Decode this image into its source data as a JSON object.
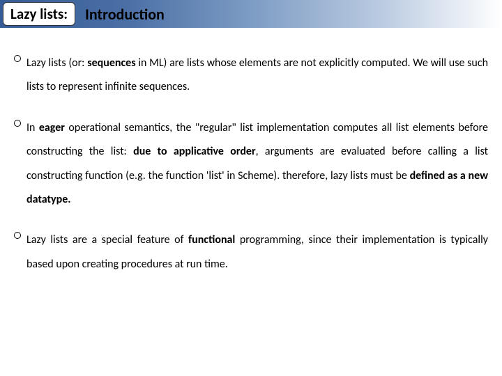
{
  "header": {
    "badge": "Lazy lists:",
    "title": "Introduction"
  },
  "bullets": {
    "b1": {
      "pre": "Lazy lists (or: ",
      "seq": "sequences",
      "mid1": " in ML) are lists whose elements are not explicitly computed. We will use such lists to represent infinite sequences."
    },
    "b2": {
      "t1": "In ",
      "eager": "eager",
      "t2": " operational semantics, the \"regular\" list implementation computes all list elements before constructing the list: ",
      "due": "due to applicative order",
      "t3": ", arguments are evaluated before calling a list constructing function (e.g. the function 'list' in Scheme). therefore, lazy lists must be ",
      "def": "defined as a new datatype."
    },
    "b3": {
      "t1": "Lazy lists are a special feature of ",
      "fn": "functional",
      "t2": " programming, since their implementation is typically based upon creating procedures at run time."
    }
  }
}
